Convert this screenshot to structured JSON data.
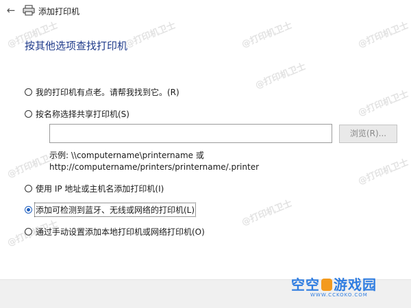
{
  "window": {
    "title": "添加打印机",
    "back_icon": "back-arrow-icon",
    "printer_icon": "printer-icon"
  },
  "heading": "按其他选项查找打印机",
  "options": [
    {
      "label": "我的打印机有点老。请帮我找到它。(R)",
      "checked": false
    },
    {
      "label": "按名称选择共享打印机(S)",
      "checked": false
    },
    {
      "label": "使用 IP 地址或主机名添加打印机(I)",
      "checked": false
    },
    {
      "label": "添加可检测到蓝牙、无线或网络的打印机(L)",
      "checked": true
    },
    {
      "label": "通过手动设置添加本地打印机或网络打印机(O)",
      "checked": false
    }
  ],
  "share_input": {
    "value": "",
    "placeholder": ""
  },
  "browse_label": "浏览(R)...",
  "example": {
    "line1": "示例: \\\\computername\\printername 或",
    "line2": "http://computername/printers/printername/.printer"
  },
  "watermark": "@打印机卫士",
  "logo": {
    "text_left": "空空",
    "text_right": "游戏园",
    "url": "WWW.CCKOKO.COM"
  },
  "colors": {
    "heading": "#1e3a8a",
    "radio_selected": "#1f5fbf",
    "footer_bg": "#f0f0f0",
    "logo_blue": "#2f7de1",
    "logo_orange": "#f39a1e"
  }
}
